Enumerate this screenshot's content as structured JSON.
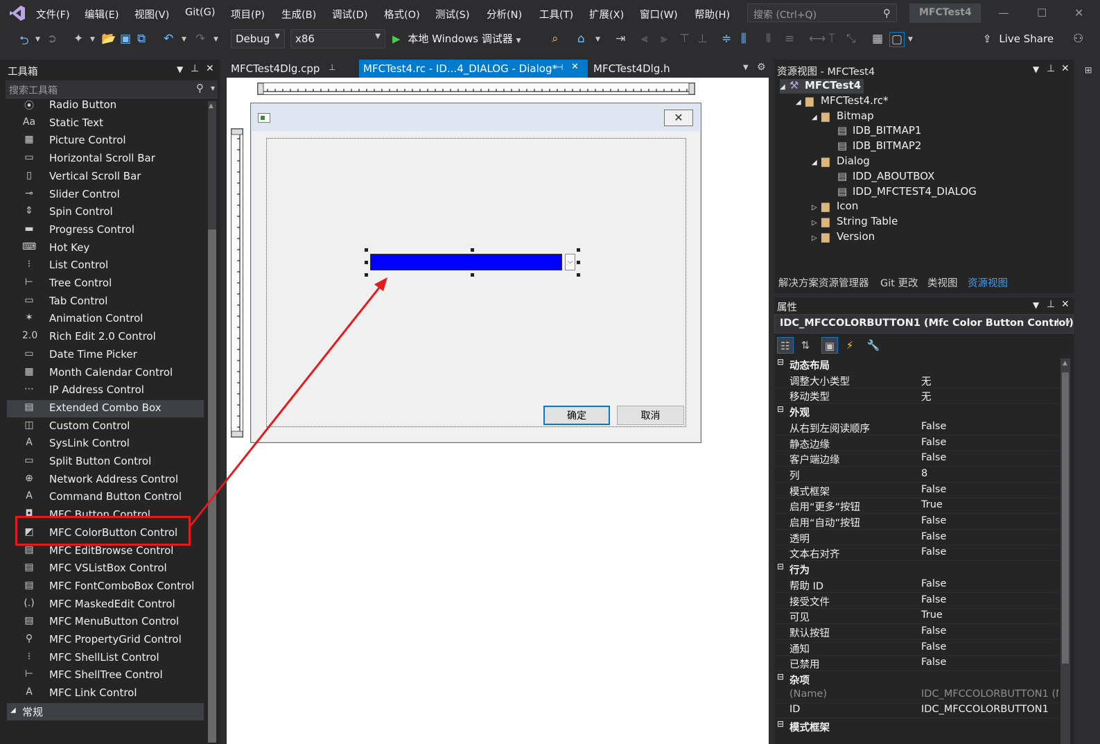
{
  "menu": [
    "文件(F)",
    "编辑(E)",
    "视图(V)",
    "Git(G)",
    "项目(P)",
    "生成(B)",
    "调试(D)",
    "格式(O)",
    "测试(S)",
    "分析(N)",
    "工具(T)",
    "扩展(X)",
    "窗口(W)",
    "帮助(H)"
  ],
  "search": {
    "placeholder": "搜索 (Ctrl+Q)"
  },
  "app_title": "MFCTest4",
  "toolbar": {
    "config": "Debug",
    "platform": "x86",
    "run_label": "本地 Windows 调试器",
    "live_share": "Live Share"
  },
  "toolbox": {
    "title": "工具箱",
    "search_placeholder": "搜索工具箱",
    "items": [
      {
        "label": "Radio Button",
        "icon": "⦿"
      },
      {
        "label": "Static Text",
        "icon": "Aa"
      },
      {
        "label": "Picture Control",
        "icon": "▦"
      },
      {
        "label": "Horizontal Scroll Bar",
        "icon": "▭"
      },
      {
        "label": "Vertical Scroll Bar",
        "icon": "▯"
      },
      {
        "label": "Slider Control",
        "icon": "⊸"
      },
      {
        "label": "Spin Control",
        "icon": "⇕"
      },
      {
        "label": "Progress Control",
        "icon": "▬"
      },
      {
        "label": "Hot Key",
        "icon": "⌨"
      },
      {
        "label": "List Control",
        "icon": "⁝"
      },
      {
        "label": "Tree Control",
        "icon": "⊢"
      },
      {
        "label": "Tab Control",
        "icon": "▭"
      },
      {
        "label": "Animation Control",
        "icon": "✶"
      },
      {
        "label": "Rich Edit 2.0 Control",
        "icon": "2.0"
      },
      {
        "label": "Date Time Picker",
        "icon": "▭"
      },
      {
        "label": "Month Calendar Control",
        "icon": "▦"
      },
      {
        "label": "IP Address Control",
        "icon": "⋯"
      },
      {
        "label": "Extended Combo Box",
        "icon": "▤"
      },
      {
        "label": "Custom Control",
        "icon": "◫"
      },
      {
        "label": "SysLink Control",
        "icon": "A"
      },
      {
        "label": "Split Button Control",
        "icon": "▭"
      },
      {
        "label": "Network Address Control",
        "icon": "⊕"
      },
      {
        "label": "Command Button Control",
        "icon": "A"
      },
      {
        "label": "MFC Button Control",
        "icon": "◘"
      },
      {
        "label": "MFC ColorButton Control",
        "icon": "◩"
      },
      {
        "label": "MFC EditBrowse Control",
        "icon": "▤"
      },
      {
        "label": "MFC VSListBox Control",
        "icon": "▤"
      },
      {
        "label": "MFC FontComboBox Control",
        "icon": "▤"
      },
      {
        "label": "MFC MaskedEdit Control",
        "icon": "(.)"
      },
      {
        "label": "MFC MenuButton Control",
        "icon": "▤"
      },
      {
        "label": "MFC PropertyGrid Control",
        "icon": "⚲"
      },
      {
        "label": "MFC ShellList Control",
        "icon": "⁝"
      },
      {
        "label": "MFC ShellTree Control",
        "icon": "⊢"
      },
      {
        "label": "MFC Link Control",
        "icon": "A"
      }
    ],
    "section": "常规"
  },
  "doc_tabs": [
    "MFCTest4Dlg.cpp",
    "MFCTest4.rc - ID...4_DIALOG - Dialog*",
    "MFCTest4Dlg.h"
  ],
  "dialog": {
    "close_glyph": "✕",
    "ok_label": "确定",
    "cancel_label": "取消",
    "color_value": "#0000ff"
  },
  "resview": {
    "title": "资源视图 - MFCTest4",
    "tree": [
      {
        "label": "MFCTest4",
        "level": 0,
        "toggle": "◢",
        "bold": true
      },
      {
        "label": "MFCTest4.rc*",
        "level": 1,
        "toggle": "◢"
      },
      {
        "label": "Bitmap",
        "level": 2,
        "toggle": "◢"
      },
      {
        "label": "IDB_BITMAP1",
        "level": 3,
        "toggle": ""
      },
      {
        "label": "IDB_BITMAP2",
        "level": 3,
        "toggle": ""
      },
      {
        "label": "Dialog",
        "level": 2,
        "toggle": "◢"
      },
      {
        "label": "IDD_ABOUTBOX",
        "level": 3,
        "toggle": ""
      },
      {
        "label": "IDD_MFCTEST4_DIALOG",
        "level": 3,
        "toggle": ""
      },
      {
        "label": "Icon",
        "level": 2,
        "toggle": "▷"
      },
      {
        "label": "String Table",
        "level": 2,
        "toggle": "▷"
      },
      {
        "label": "Version",
        "level": 2,
        "toggle": "▷"
      }
    ],
    "tabs": [
      "解决方案资源管理器",
      "Git 更改",
      "类视图",
      "资源视图"
    ]
  },
  "props": {
    "title": "属性",
    "object": "IDC_MFCCOLORBUTTON1 (Mfc Color Button Control)",
    "object_suffix": "I",
    "rows": [
      {
        "type": "cat",
        "label": "动态布局"
      },
      {
        "type": "row",
        "k": "调整大小类型",
        "v": "无"
      },
      {
        "type": "row",
        "k": "移动类型",
        "v": "无"
      },
      {
        "type": "cat",
        "label": "外观"
      },
      {
        "type": "row",
        "k": "从右到左阅读顺序",
        "v": "False"
      },
      {
        "type": "row",
        "k": "静态边缘",
        "v": "False"
      },
      {
        "type": "row",
        "k": "客户端边缘",
        "v": "False"
      },
      {
        "type": "row",
        "k": "列",
        "v": "8"
      },
      {
        "type": "row",
        "k": "模式框架",
        "v": "False"
      },
      {
        "type": "row",
        "k": "启用“更多”按钮",
        "v": "True"
      },
      {
        "type": "row",
        "k": "启用“自动”按钮",
        "v": "False"
      },
      {
        "type": "row",
        "k": "透明",
        "v": "False"
      },
      {
        "type": "row",
        "k": "文本右对齐",
        "v": "False"
      },
      {
        "type": "cat",
        "label": "行为"
      },
      {
        "type": "row",
        "k": "帮助 ID",
        "v": "False"
      },
      {
        "type": "row",
        "k": "接受文件",
        "v": "False"
      },
      {
        "type": "row",
        "k": "可见",
        "v": "True"
      },
      {
        "type": "row",
        "k": "默认按钮",
        "v": "False"
      },
      {
        "type": "row",
        "k": "通知",
        "v": "False"
      },
      {
        "type": "row",
        "k": "已禁用",
        "v": "False"
      },
      {
        "type": "cat",
        "label": "杂项"
      },
      {
        "type": "row",
        "k": "(Name)",
        "v": "IDC_MFCCOLORBUTTON1 (M",
        "dim": true
      },
      {
        "type": "row",
        "k": "ID",
        "v": "IDC_MFCCOLORBUTTON1"
      },
      {
        "type": "cat",
        "label": "模式框架"
      }
    ]
  },
  "colors": {
    "accent": "#007acc",
    "annotation": "#e41a1c"
  }
}
